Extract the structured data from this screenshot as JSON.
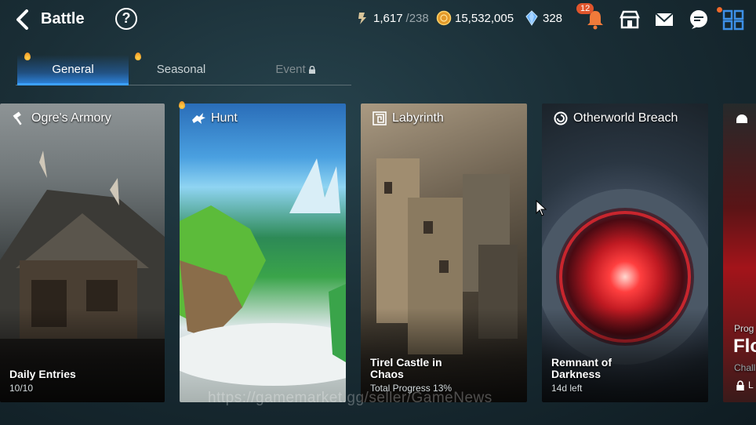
{
  "header": {
    "title": "Battle",
    "help_glyph": "?",
    "resources": [
      {
        "icon": "stamina-icon",
        "value": "1,617",
        "sub": "/238"
      },
      {
        "icon": "gold-coin-icon",
        "value": "15,532,005"
      },
      {
        "icon": "crystal-icon",
        "value": "328"
      }
    ],
    "notification_count": "12",
    "actions": [
      "bell-icon",
      "shop-icon",
      "mail-icon",
      "chat-icon",
      "menu-grid-icon"
    ]
  },
  "tabs": [
    {
      "label": "General",
      "active": true
    },
    {
      "label": "Seasonal",
      "active": false
    },
    {
      "label": "Event",
      "locked": true
    }
  ],
  "cards": [
    {
      "title": "Ogre's Armory",
      "icon": "hammer-icon",
      "line1": "Daily Entries",
      "line2": "10/10"
    },
    {
      "title": "Hunt",
      "icon": "dragon-icon",
      "line1": "",
      "line2": ""
    },
    {
      "title": "Labyrinth",
      "icon": "maze-icon",
      "line1": "Tirel Castle in",
      "line1b": "Chaos",
      "line2": "Total Progress 13%"
    },
    {
      "title": "Otherworld Breach",
      "icon": "portal-icon",
      "line1": "Remnant of",
      "line1b": "Darkness",
      "line2": "14d left"
    },
    {
      "title": "",
      "icon": "helmet-icon",
      "line0": "Prog",
      "line1": "Flo",
      "line2": "Chall",
      "line3": "L"
    }
  ],
  "watermark": "https://gamemarket.gg/seller/GameNews",
  "colors": {
    "accent": "#2d86e0",
    "badge": "#e0552c"
  }
}
